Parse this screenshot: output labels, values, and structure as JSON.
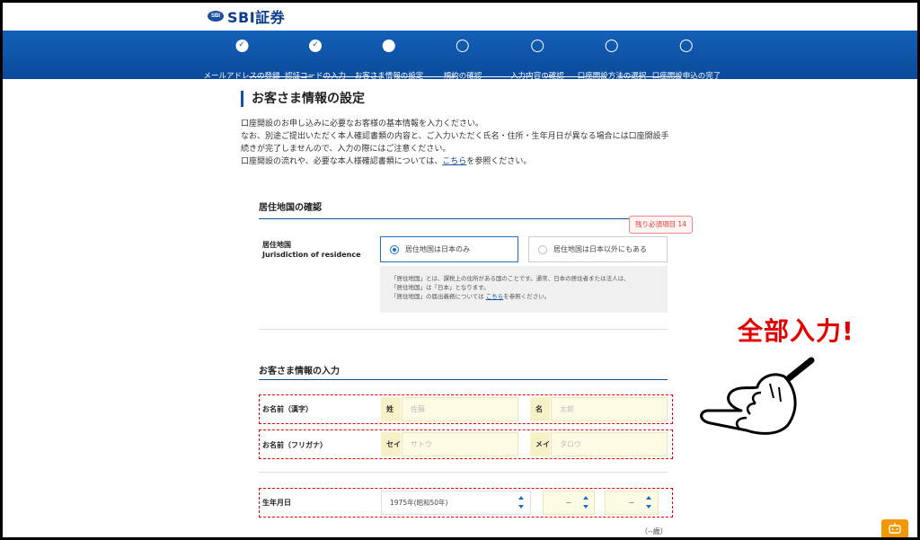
{
  "brand": {
    "mark": "SBI",
    "name": "SBI証券"
  },
  "steps": [
    {
      "label": "メールアドレスの登録",
      "state": "done"
    },
    {
      "label": "認証コードの入力",
      "state": "done"
    },
    {
      "label": "お客さま情報の設定",
      "state": "current"
    },
    {
      "label": "規約の確認",
      "state": "todo"
    },
    {
      "label": "入力内容の確認",
      "state": "todo"
    },
    {
      "label": "口座開設方法の選択",
      "state": "todo"
    },
    {
      "label": "口座開設申込の完了",
      "state": "todo"
    }
  ],
  "page": {
    "title": "お客さま情報の設定",
    "intro": [
      "口座開設のお申し込みに必要なお客様の基本情報を入力ください。",
      "なお、別途ご提出いただく本人確認書類の内容と、ご入力いただく氏名・住所・生年月日が異なる場合には口座開設手",
      "続きが完了しませんので、入力の際にはご注意ください。"
    ],
    "intro_flow_prefix": "口座開設の流れや、必要な本人様確認書類については、",
    "intro_flow_link": "こちら",
    "intro_flow_suffix": "を参照ください。"
  },
  "residence": {
    "section_title": "居住地国の確認",
    "remaining_badge": "残り必須項目 14",
    "label_ja": "居住地国",
    "label_en": "Jurisdiction of residence",
    "option_japan": "居住地国は日本のみ",
    "option_other": "居住地国は日本以外にもある",
    "selected": "japan",
    "note_line1": "「居住地国」とは、課税上の住所がある国のことです。通常、日本の居住者または法人は、",
    "note_line2": "「居住地国」は「日本」となります。",
    "note_line3_prefix": "「居住地国」の届出義務については ",
    "note_link": "こちら",
    "note_line3_suffix": "を参照ください。"
  },
  "customer": {
    "section_title": "お客さま情報の入力",
    "name_kanji_label": "お名前（漢字）",
    "sei_tag": "姓",
    "sei_placeholder": "佐藤",
    "mei_tag": "名",
    "mei_placeholder": "太郎",
    "name_kana_label": "お名前（フリガナ）",
    "sei_kana_tag": "セイ",
    "sei_kana_placeholder": "サトウ",
    "mei_kana_tag": "メイ",
    "mei_kana_placeholder": "タロウ",
    "birth_label": "生年月日",
    "birth_year": "1975年(昭和50年)",
    "birth_month": "－",
    "birth_day": "－",
    "age": "（--歳）"
  },
  "annotation": {
    "callout": "全部入力!"
  },
  "colors": {
    "brand_blue": "#1460b8",
    "required_red": "#e00000",
    "input_yellow": "#fdfbe3"
  }
}
